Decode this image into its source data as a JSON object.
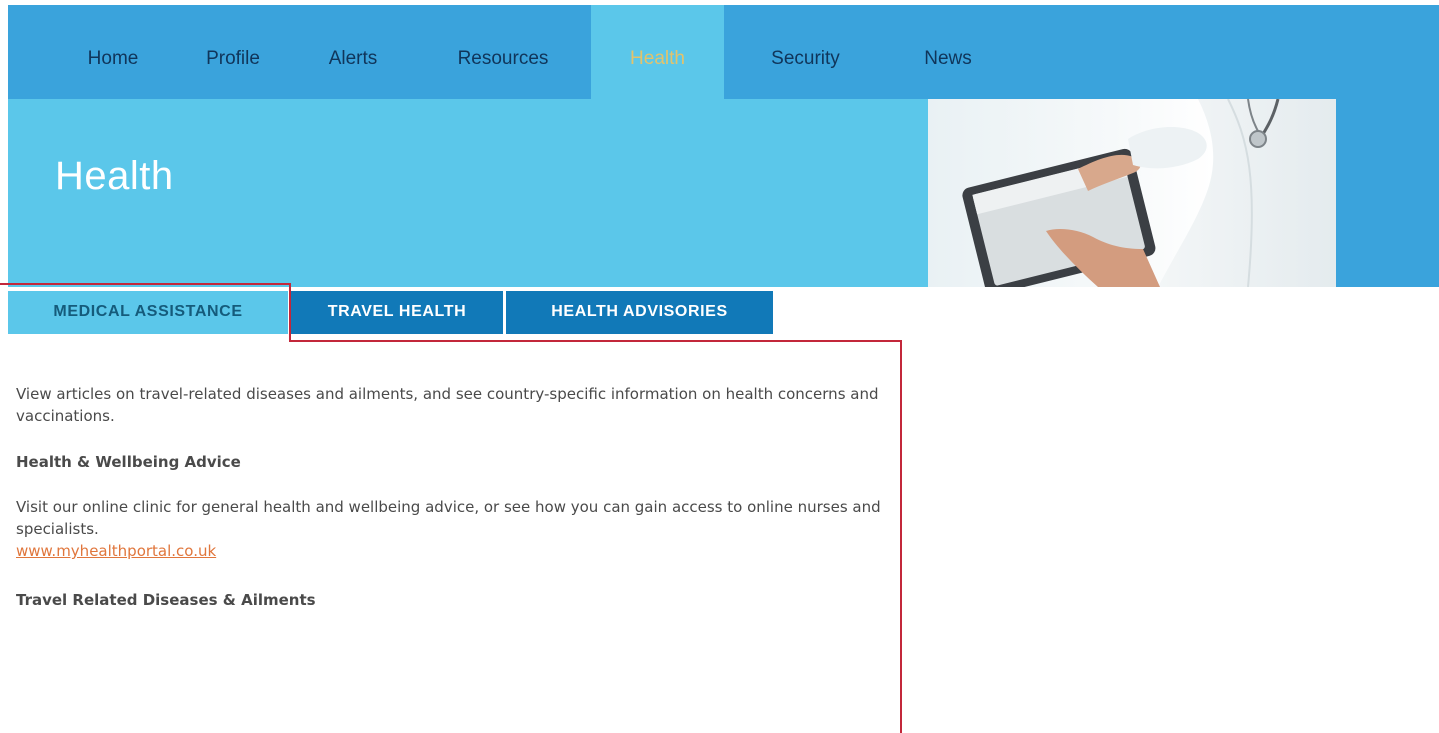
{
  "nav": {
    "items": [
      {
        "label": "Home"
      },
      {
        "label": "Profile"
      },
      {
        "label": "Alerts"
      },
      {
        "label": "Resources"
      },
      {
        "label": "Health"
      },
      {
        "label": "Security"
      },
      {
        "label": "News"
      }
    ],
    "active": "Health"
  },
  "hero": {
    "title": "Health",
    "image": "doctor-with-tablet-photo"
  },
  "tabs": [
    {
      "label": "MEDICAL ASSISTANCE",
      "state": "active"
    },
    {
      "label": "TRAVEL HEALTH",
      "state": "inactive"
    },
    {
      "label": "HEALTH ADVISORIES",
      "state": "inactive"
    }
  ],
  "content": {
    "intro": "View articles on travel-related diseases and ailments, and see country-specific information on health concerns and vaccinations.",
    "section1": {
      "heading": "Health & Wellbeing Advice",
      "text": "Visit our online clinic for general health and wellbeing advice, or see how you can gain access to online nurses and specialists.",
      "link": "www.myhealthportal.co.uk"
    },
    "section2": {
      "heading": "Travel Related Diseases & Ailments"
    }
  },
  "colors": {
    "nav_bg": "#3aa3dc",
    "hero_bg": "#5bc7ea",
    "active_nav_text": "#e3c36b",
    "nav_text": "#10355a",
    "tab_active_bg": "#5bc7ea",
    "tab_inactive_bg": "#1179b8",
    "link": "#e0763c",
    "highlight": "#c3273a"
  }
}
